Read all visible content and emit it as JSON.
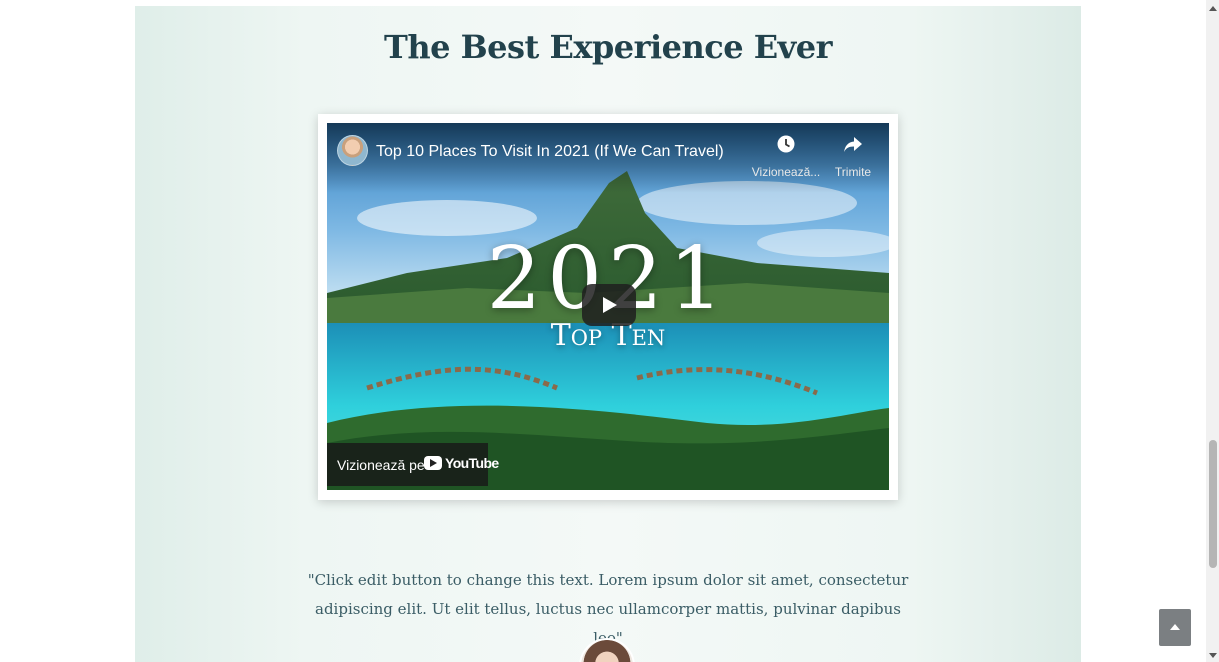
{
  "section": {
    "title": "The Best Experience Ever",
    "quote": "\"Click edit button to change this text. Lorem ipsum dolor sit amet, consectetur adipiscing elit. Ut elit tellus, luctus nec ullamcorper mattis, pulvinar dapibus leo\""
  },
  "video": {
    "title": "Top 10 Places To Visit In 2021 (If We Can Travel)",
    "thumbnail_year": "2021",
    "thumbnail_subtitle": "Top Ten",
    "watch_later_label": "Vizionează...",
    "share_label": "Trimite",
    "watch_on_label": "Vizionează pe",
    "youtube_wordmark": "YouTube",
    "icons": {
      "watch_later": "clock-icon",
      "share": "share-arrow-icon",
      "play": "play-icon",
      "youtube": "youtube-logo-icon"
    }
  },
  "colors": {
    "title": "#22424c",
    "quote": "#3b5d66",
    "section_bg": "#eef6f3",
    "back_to_top": "#7b7f82"
  },
  "ui": {
    "back_to_top_icon": "chevron-up-icon"
  }
}
